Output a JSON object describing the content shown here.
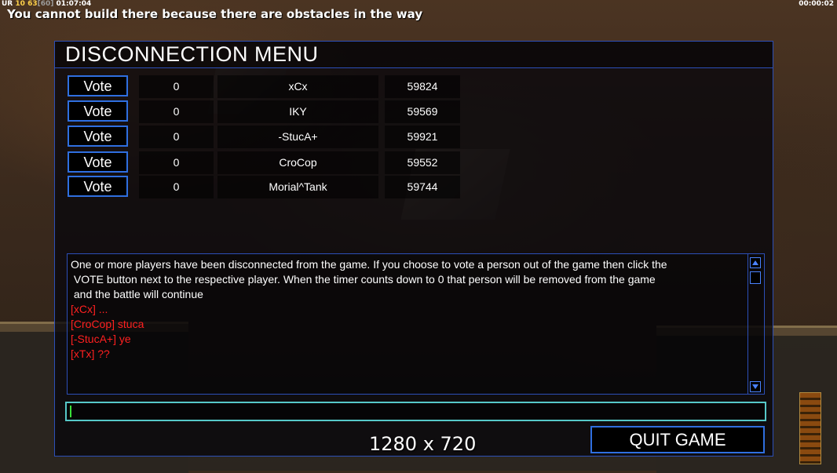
{
  "top_overlay": {
    "stats_prefix": "UR",
    "stats_a": "10",
    "stats_b": "63",
    "stats_c": "[60]",
    "clock": "01:07:04",
    "timer": "00:00:02",
    "warning": "You cannot build there because there are obstacles in the way"
  },
  "dialog": {
    "title": "DISCONNECTION MENU",
    "players": [
      {
        "vote_label": "Vote",
        "votes": "0",
        "name": "xCx",
        "ping": "59824"
      },
      {
        "vote_label": "Vote",
        "votes": "0",
        "name": "IKY",
        "ping": "59569"
      },
      {
        "vote_label": "Vote",
        "votes": "0",
        "name": "-StucA+",
        "ping": "59921"
      },
      {
        "vote_label": "Vote",
        "votes": "0",
        "name": "CroCop",
        "ping": "59552"
      },
      {
        "vote_label": "Vote",
        "votes": "0",
        "name": "Morial^Tank",
        "ping": "59744"
      }
    ],
    "message_lines": [
      "One or more players have been disconnected from the game. If you choose to vote a person out of the game then click the",
      " VOTE button next to the respective player. When the timer counts down to 0 that person will be removed from the game",
      " and the battle will continue"
    ],
    "chat": [
      "[xCx] ...",
      "[CroCop] stuca",
      "[-StucA+] ye",
      "[xTx] ??"
    ],
    "chat_input_value": "",
    "quit_label": "QUIT GAME"
  },
  "resolution_label": "1280 x 720",
  "colors": {
    "accent_blue": "#2f6fe0",
    "chat_red": "#ff2020",
    "input_border": "#56c8c8"
  }
}
